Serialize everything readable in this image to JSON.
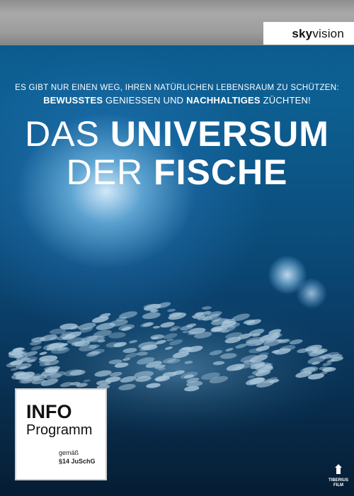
{
  "brand": {
    "sky": "sky",
    "vision": "vision"
  },
  "tagline": {
    "line1": "Es gibt nur einen Weg, ihren natürlichen Lebensraum zu schützen:",
    "line2_bold1": "Bewusstes",
    "line2_mid": " geniessen und ",
    "line2_bold2": "Nachhaltiges",
    "line2_end": " züchten!"
  },
  "title": {
    "line1_thin": "Das ",
    "line1_bold": "Universum",
    "line2_thin": "der ",
    "line2_bold": "Fische"
  },
  "rating": {
    "line1": "INFO",
    "line2": "Programm",
    "line3": "gemäß",
    "line4": "§14 JuSchG"
  },
  "studio": {
    "line1": "TIBERIUS",
    "line2": "FILM"
  },
  "colors": {
    "ocean_top": "#0c5a8e",
    "ocean_bottom": "#061d33",
    "topbar": "#9d9d9d"
  }
}
